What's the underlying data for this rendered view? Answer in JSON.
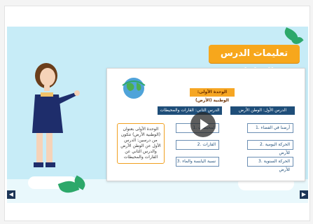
{
  "header": {
    "title": "تعليمات الدرس التفاعلي"
  },
  "map": {
    "root": "الوحدة الأولى: الوطنية (الأرض)",
    "left_branch_title": "الدرس الثاني: القارات والمحيطات",
    "right_branch_title": "الدرس الأول: الوطن الأرض",
    "left_items": [
      "1. المحيطات",
      "2. القارات",
      "3. نسبة اليابسة والماء"
    ],
    "right_items": [
      "1. أرضنا في الفضاء",
      "2. الحركة اليومية للأرض",
      "3. الحركة السنوية للأرض"
    ],
    "note": "الوحدة الأولى بعنوان (الوطنية الأرض) تتكون من درسين: الدرس الأول عن الوطن الأرض والدرس الثاني عن القارات والمحيطات"
  },
  "controls": {
    "play": "تشغيل",
    "prev": "◀",
    "next": "▶"
  },
  "colors": {
    "banner": "#f7a71c",
    "sky": "#c7ecf7",
    "navy": "#1f4e79"
  }
}
